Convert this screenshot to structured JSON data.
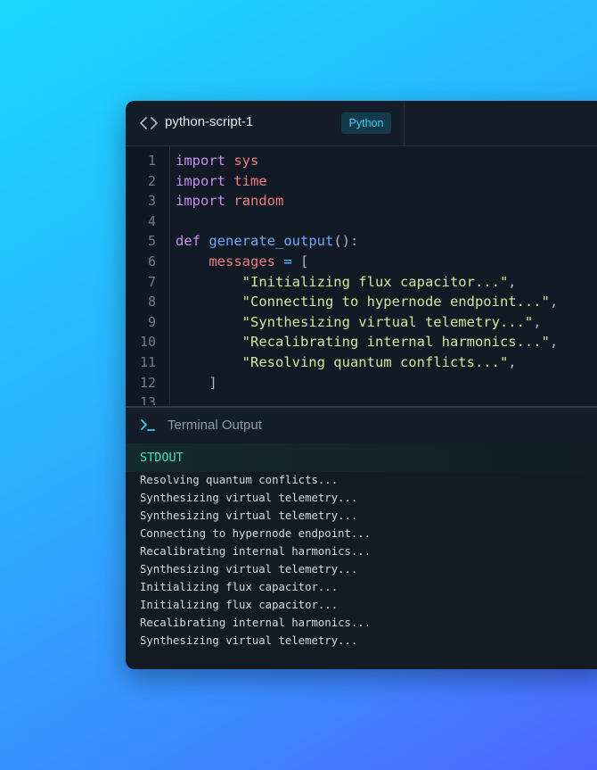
{
  "editor": {
    "script_name": "python-script-1",
    "language": "Python",
    "line_numbers": [
      "1",
      "2",
      "3",
      "4",
      "5",
      "6",
      "7",
      "8",
      "9",
      "10",
      "11",
      "12",
      "13"
    ],
    "code_lines": [
      [
        {
          "t": "import",
          "c": "kw"
        },
        {
          "t": " ",
          "c": ""
        },
        {
          "t": "sys",
          "c": "mod"
        }
      ],
      [
        {
          "t": "import",
          "c": "kw"
        },
        {
          "t": " ",
          "c": ""
        },
        {
          "t": "time",
          "c": "mod"
        }
      ],
      [
        {
          "t": "import",
          "c": "kw"
        },
        {
          "t": " ",
          "c": ""
        },
        {
          "t": "random",
          "c": "mod"
        }
      ],
      [],
      [
        {
          "t": "def",
          "c": "kw"
        },
        {
          "t": " ",
          "c": ""
        },
        {
          "t": "generate_output",
          "c": "fn"
        },
        {
          "t": "():",
          "c": "punc"
        }
      ],
      [
        {
          "t": "    ",
          "c": ""
        },
        {
          "t": "messages",
          "c": "var"
        },
        {
          "t": " ",
          "c": ""
        },
        {
          "t": "=",
          "c": "op"
        },
        {
          "t": " ",
          "c": ""
        },
        {
          "t": "[",
          "c": "punc"
        }
      ],
      [
        {
          "t": "        ",
          "c": ""
        },
        {
          "t": "\"Initializing flux capacitor...\"",
          "c": "str"
        },
        {
          "t": ",",
          "c": "punc"
        }
      ],
      [
        {
          "t": "        ",
          "c": ""
        },
        {
          "t": "\"Connecting to hypernode endpoint...\"",
          "c": "str"
        },
        {
          "t": ",",
          "c": "punc"
        }
      ],
      [
        {
          "t": "        ",
          "c": ""
        },
        {
          "t": "\"Synthesizing virtual telemetry...\"",
          "c": "str"
        },
        {
          "t": ",",
          "c": "punc"
        }
      ],
      [
        {
          "t": "        ",
          "c": ""
        },
        {
          "t": "\"Recalibrating internal harmonics...\"",
          "c": "str"
        },
        {
          "t": ",",
          "c": "punc"
        }
      ],
      [
        {
          "t": "        ",
          "c": ""
        },
        {
          "t": "\"Resolving quantum conflicts...\"",
          "c": "str"
        },
        {
          "t": ",",
          "c": "punc"
        }
      ],
      [
        {
          "t": "    ",
          "c": ""
        },
        {
          "t": "]",
          "c": "punc"
        }
      ],
      []
    ]
  },
  "terminal": {
    "title": "Terminal Output",
    "stream_label": "STDOUT",
    "output_lines": [
      "Resolving quantum conflicts...",
      "Synthesizing virtual telemetry...",
      "Synthesizing virtual telemetry...",
      "Connecting to hypernode endpoint...",
      "Recalibrating internal harmonics...",
      "Synthesizing virtual telemetry...",
      "Initializing flux capacitor...",
      "Initializing flux capacitor...",
      "Recalibrating internal harmonics...",
      "Synthesizing virtual telemetry..."
    ]
  },
  "icons": {
    "header_icon": "code-brackets-icon",
    "terminal_icon": "terminal-prompt-icon"
  },
  "colors": {
    "accent": "#3fd0f2",
    "stdout": "#43e3b0",
    "keyword": "#c88bf0",
    "string": "#cfe89a"
  }
}
